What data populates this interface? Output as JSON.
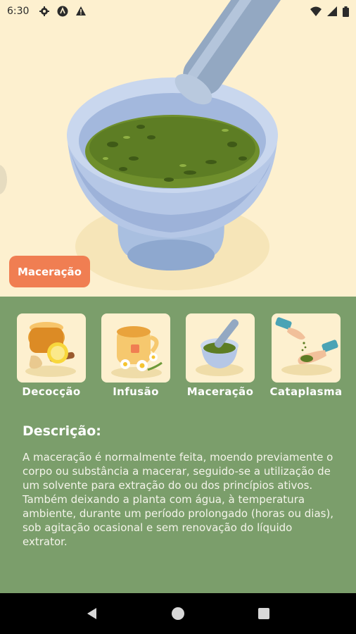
{
  "status_bar": {
    "time": "6:30",
    "left_icons": [
      "gear-icon",
      "accessibility-icon",
      "warning-icon"
    ],
    "right_icons": [
      "wifi-icon",
      "signal-icon",
      "battery-icon"
    ]
  },
  "hero": {
    "illustration": "mortar-and-pestle-with-herbs",
    "tag_label": "Maceração"
  },
  "methods": [
    {
      "label": "Decocção",
      "icon": "ginger-lemon-pot-icon"
    },
    {
      "label": "Infusão",
      "icon": "chamomile-tea-icon"
    },
    {
      "label": "Maceração",
      "icon": "mortar-pestle-icon"
    },
    {
      "label": "Cataplasma",
      "icon": "hands-herbs-icon"
    }
  ],
  "description": {
    "title": "Descrição:",
    "text": "A maceração é normalmente feita, moendo previamente o corpo ou substância a macerar, seguido-se a utilização de um solvente para extração do ou dos princípios ativos. Também deixando a planta com água, à temperatura ambiente, durante um período prolongado (horas ou dias), sob agitação ocasional e sem renovação do líquido extrator."
  },
  "colors": {
    "hero_bg": "#fdf0cf",
    "panel_bg": "#7b9e6b",
    "tag_bg": "#f07e52",
    "nav_bg": "#000000"
  },
  "navbar": [
    "back-icon",
    "home-icon",
    "recents-icon"
  ]
}
